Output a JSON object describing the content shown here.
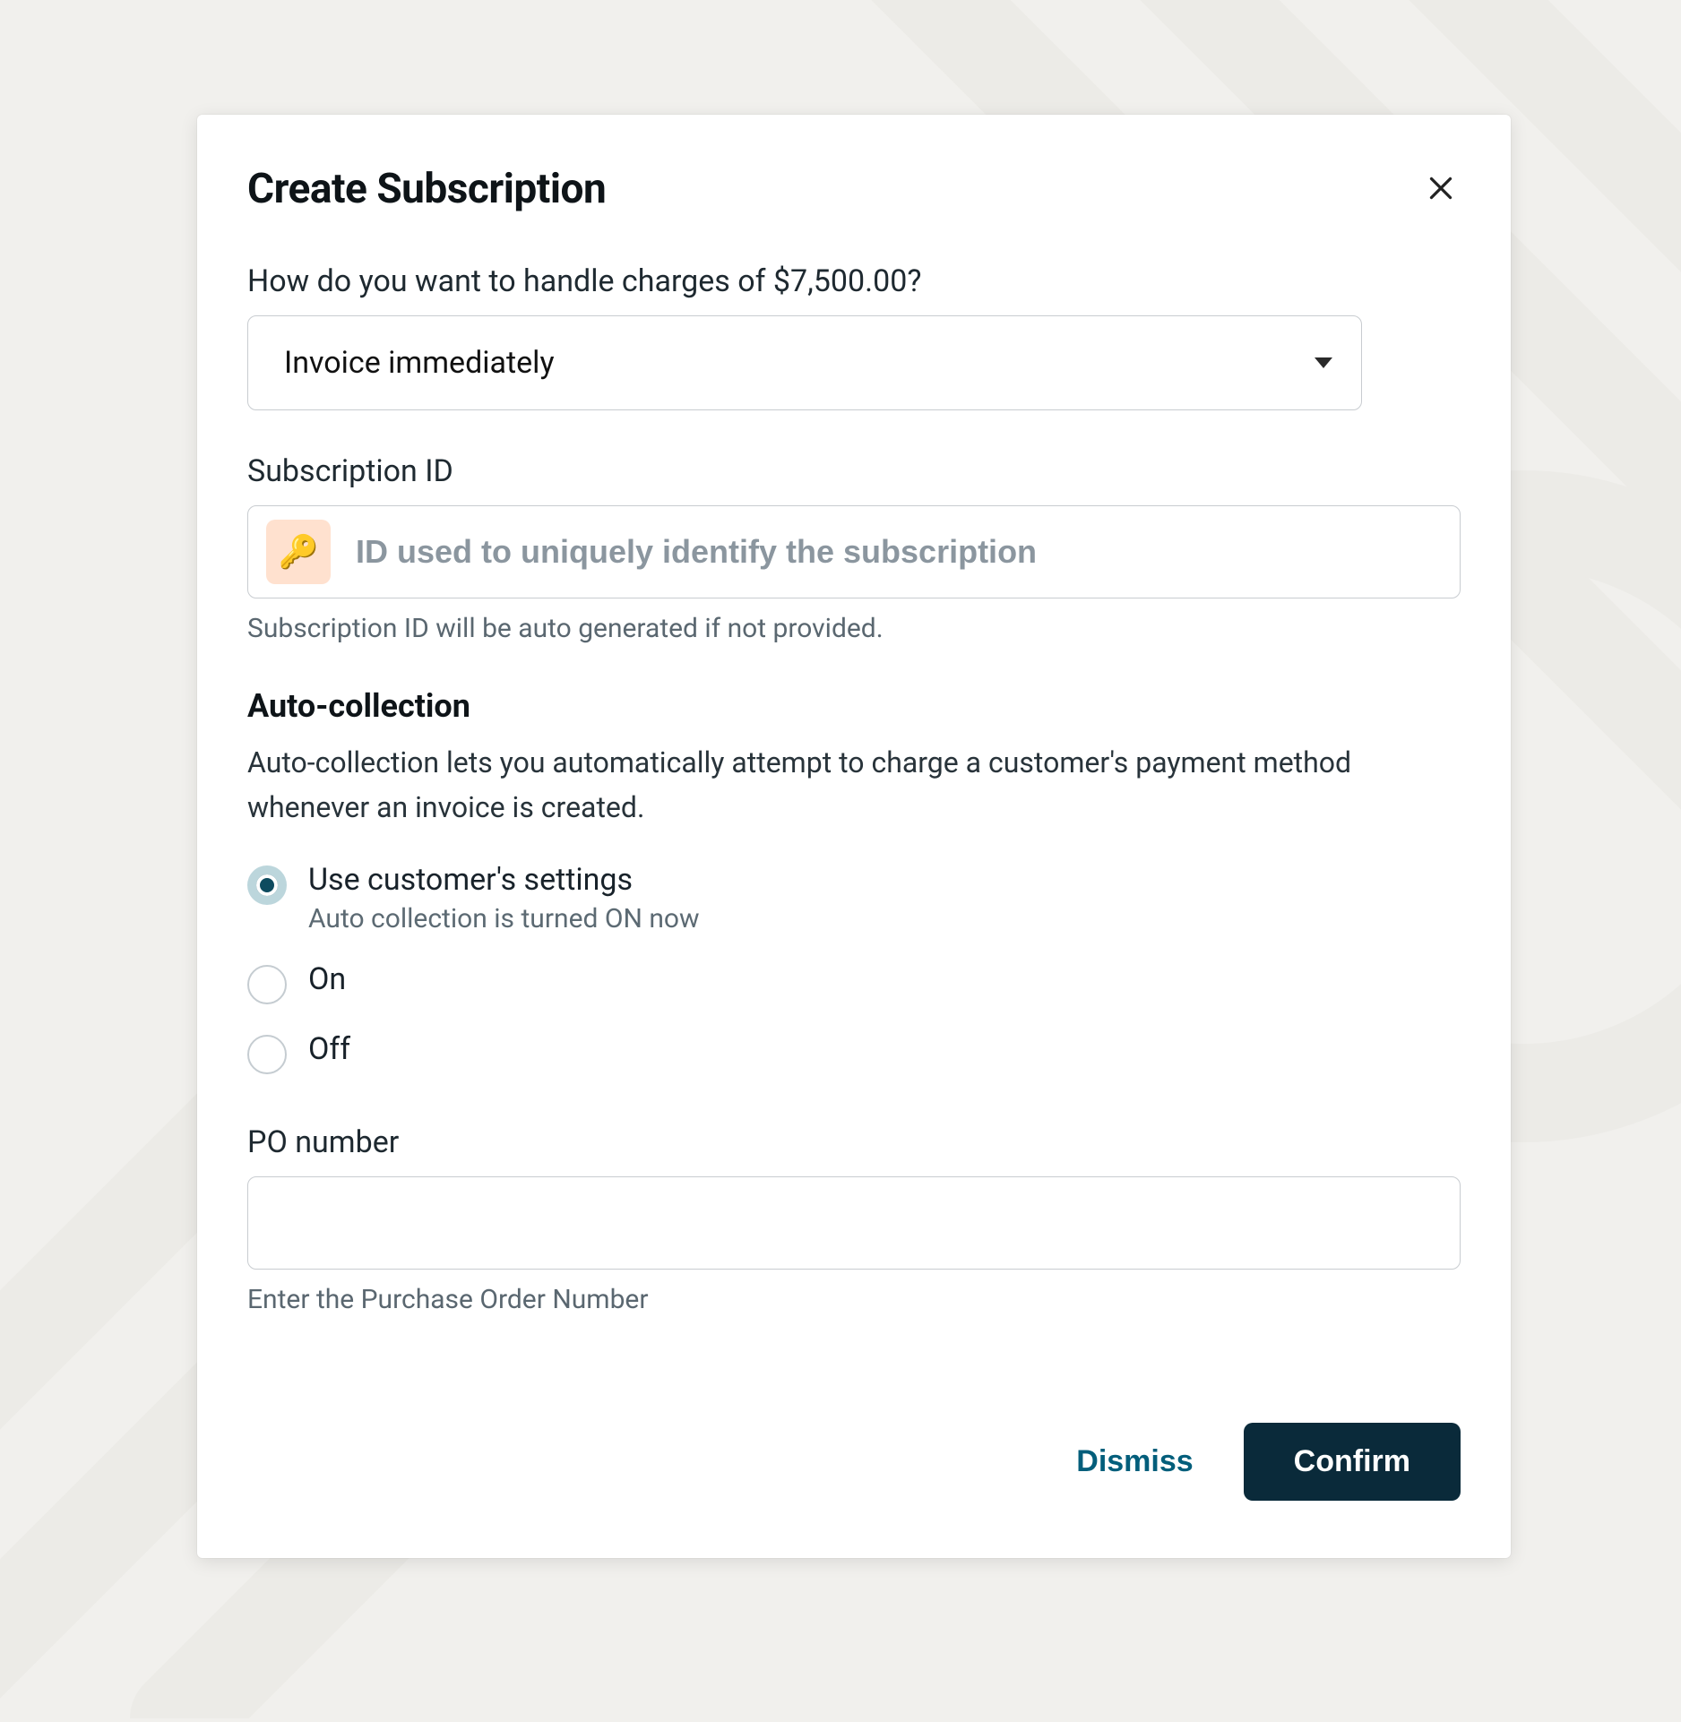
{
  "colors": {
    "accent": "#035e7b",
    "dark": "#0a2a3a"
  },
  "dialog": {
    "title": "Create Subscription"
  },
  "charges": {
    "label": "How do you want to handle charges of $7,500.00?",
    "selected": "Invoice immediately"
  },
  "subscription_id": {
    "label": "Subscription ID",
    "placeholder": "ID used to uniquely identify the subscription",
    "helper": "Subscription ID will be auto generated if not provided.",
    "value": ""
  },
  "auto_collection": {
    "title": "Auto-collection",
    "description": "Auto-collection lets you automatically attempt to charge a customer's payment method whenever an invoice is created.",
    "options": [
      {
        "label": "Use customer's settings",
        "sub": "Auto collection is turned ON now",
        "selected": true
      },
      {
        "label": "On",
        "selected": false
      },
      {
        "label": "Off",
        "selected": false
      }
    ]
  },
  "po_number": {
    "label": "PO number",
    "helper": "Enter the Purchase Order Number",
    "value": ""
  },
  "footer": {
    "dismiss": "Dismiss",
    "confirm": "Confirm"
  }
}
